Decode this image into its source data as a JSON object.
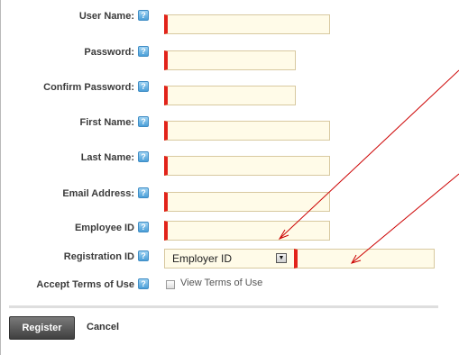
{
  "form": {
    "fields": [
      {
        "label": "User Name:",
        "value": ""
      },
      {
        "label": "Password:",
        "value": ""
      },
      {
        "label": "Confirm Password:",
        "value": ""
      },
      {
        "label": "First Name:",
        "value": ""
      },
      {
        "label": "Last Name:",
        "value": ""
      },
      {
        "label": "Email Address:",
        "value": ""
      },
      {
        "label": "Employee ID",
        "value": ""
      }
    ],
    "registration": {
      "label": "Registration ID",
      "selected": "Employer ID",
      "value": ""
    },
    "terms": {
      "label": "Accept Terms of Use",
      "link_text": "View Terms of Use",
      "checked": false
    },
    "help_glyph": "?"
  },
  "actions": {
    "register": "Register",
    "cancel": "Cancel"
  },
  "colors": {
    "required_marker": "#e2231a",
    "field_bg": "#fffbe8",
    "annotation_arrow": "#cc0000"
  }
}
